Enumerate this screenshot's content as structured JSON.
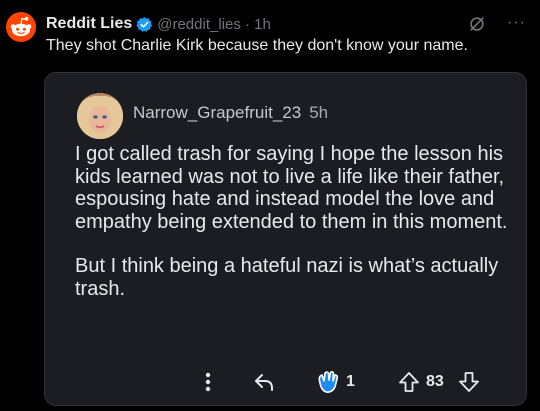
{
  "tweet": {
    "author_name": "Reddit Lies",
    "handle_time": "@reddit_lies · 1h",
    "text": "They shot Charlie Kirk because they don't know your name.",
    "more_label": "···"
  },
  "quoted_post": {
    "username": "Narrow_Grapefruit_23",
    "time": "5h",
    "paragraphs": [
      "I got called trash for saying I hope the lesson his kids learned was not to live a life like their father, espousing hate and instead model the love and empathy being extended to them in this moment.",
      "But I think being a hateful nazi is what’s actually trash."
    ],
    "award_count": "1",
    "vote_count": "83"
  },
  "colors": {
    "background": "#000000",
    "card": "#1b1d22",
    "reddit_orange": "#ff4500",
    "verified_blue": "#1d9bf0",
    "award_blue": "#1d8cf8",
    "muted_text": "#71767b"
  },
  "icons": [
    "reddit-logo-icon",
    "verified-badge-icon",
    "grok-icon",
    "more-icon",
    "more-vertical-icon",
    "reply-icon",
    "award-icon",
    "upvote-icon",
    "downvote-icon"
  ]
}
